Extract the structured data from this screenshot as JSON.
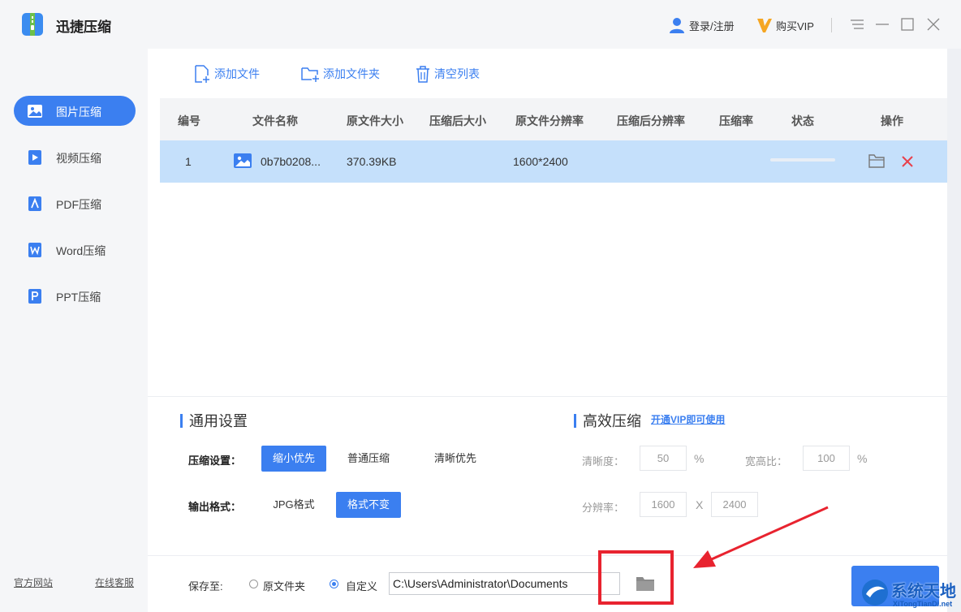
{
  "app": {
    "title": "迅捷压缩"
  },
  "header": {
    "login_label": "登录/注册",
    "vip_label": "购买VIP"
  },
  "sidebar": {
    "items": [
      {
        "label": "图片压缩",
        "icon": "image-icon",
        "active": true
      },
      {
        "label": "视频压缩",
        "icon": "video-icon",
        "active": false
      },
      {
        "label": "PDF压缩",
        "icon": "pdf-icon",
        "active": false
      },
      {
        "label": "Word压缩",
        "icon": "word-icon",
        "active": false
      },
      {
        "label": "PPT压缩",
        "icon": "ppt-icon",
        "active": false
      }
    ],
    "footer": {
      "website": "官方网站",
      "support": "在线客服"
    }
  },
  "toolbar": {
    "add_file": "添加文件",
    "add_folder": "添加文件夹",
    "clear_list": "清空列表"
  },
  "table": {
    "columns": [
      "编号",
      "文件名称",
      "原文件大小",
      "压缩后大小",
      "原文件分辨率",
      "压缩后分辨率",
      "压缩率",
      "状态",
      "操作"
    ],
    "rows": [
      {
        "index": "1",
        "name": "0b7b0208...",
        "orig_size": "370.39KB",
        "comp_size": "",
        "orig_res": "1600*2400",
        "comp_res": "",
        "ratio": "",
        "progress": 0
      }
    ]
  },
  "settings": {
    "general_title": "通用设置",
    "compress_label": "压缩设置：",
    "compress_options": [
      "缩小优先",
      "普通压缩",
      "清晰优先"
    ],
    "compress_selected": "缩小优先",
    "format_label": "输出格式：",
    "format_options": [
      "JPG格式",
      "格式不变"
    ],
    "format_selected": "格式不变"
  },
  "advanced": {
    "title": "高效压缩",
    "vip_link": "开通VIP即可使用",
    "clarity_label": "清晰度：",
    "clarity_value": "50",
    "clarity_unit": "%",
    "aspect_label": "宽高比：",
    "aspect_value": "100",
    "aspect_unit": "%",
    "resolution_label": "分辨率：",
    "res_width": "1600",
    "res_x": "X",
    "res_height": "2400"
  },
  "save": {
    "label": "保存至:",
    "option_original": "原文件夹",
    "option_custom": "自定义",
    "selected": "自定义",
    "path": "C:\\Users\\Administrator\\Documents"
  },
  "watermark": {
    "text": "系统天地",
    "sub": "XiTongTianDi.net"
  },
  "colors": {
    "accent": "#3b7ff0",
    "row_highlight": "#c5e0fb",
    "annotation": "#e8232f"
  }
}
